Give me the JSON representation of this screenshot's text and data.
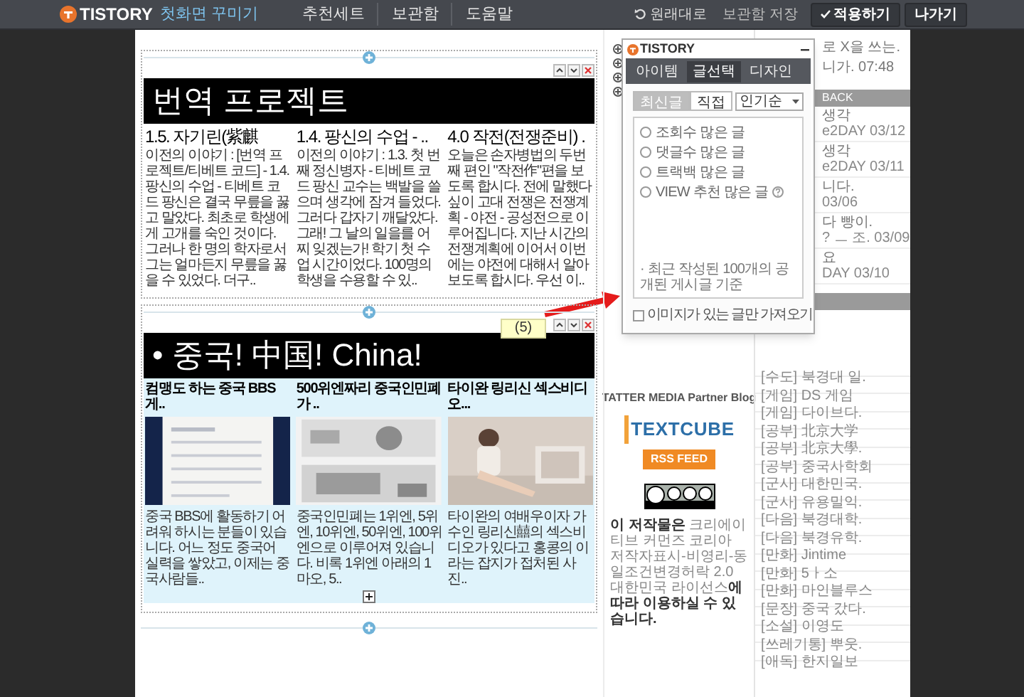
{
  "topbar": {
    "logo": "TISTORY",
    "title": "첫화면 꾸미기",
    "menu": [
      "추천세트",
      "보관함",
      "도움말"
    ],
    "actions": [
      {
        "label": "원래대로",
        "kind": "undo"
      },
      {
        "label": "보관함 저장",
        "kind": "link"
      },
      {
        "label": "적용하기",
        "kind": "primary"
      },
      {
        "label": "나가기",
        "kind": "button"
      }
    ]
  },
  "modules": [
    {
      "kind": "text",
      "title": "번역 프로젝트",
      "posts": [
        {
          "title": "1.5. 자기린(紫麒",
          "excerpt": "이전의 이야기 : [번역 프로젝트/티베트 코드] - 1.4. 팡신의 수업 - 티베트 코드 팡신은 결국 무릎을 꿇고 말았다. 최초로 학생에게 고개를 숙인 것이다. 그러나 한 명의 학자로서 그는 얼마든지 무릎을 꿇을 수 있었다. 더구.."
        },
        {
          "title": "1.4. 팡신의 수업 - ..",
          "excerpt": "이전의 이야기 : 1.3. 첫 번째 정신병자 - 티베트 코드 팡신 교수는 백발을 쓸으며 생각에 잠겨 들었다. 그러다 갑자기 깨달았다. 그래! 그 날의 일을를 어찌 잊겠는가! 학기 첫 수업 시간이었다. 100명의 학생을 수용할 수 있.."
        },
        {
          "title": "4.0 작전(전쟁준비) .",
          "excerpt": "오늘은 손자병법의 두번째 편인 \"작전作\"편을 보도록 합시다. 전에 말했다 싶이 고대 전쟁은 전쟁계획 - 야전 - 공성전으로 이루어집니다. 지난 시간의 전쟁계획에 이어서 이번에는 야전에 대해서 알아보도록 합시다. 우선 이.."
        }
      ]
    },
    {
      "title": "• 중국! 中国! China!",
      "posts": [
        {
          "title": "컴맹도 하는 중국 BBS 게..",
          "excerpt": "중국 BBS에 활동하기 어려워 하시는 분들이 있습니다. 어느 정도 중국어 실력을 쌓았고, 이제는 중국사람들.."
        },
        {
          "title": "500위엔짜리 중국인민폐가 ..",
          "excerpt": "중국인민폐는 1위엔, 5위엔, 10위엔, 50위엔, 100위엔으로 이루어져 있습니다. 비록 1위엔 아래의 1마오, 5.."
        },
        {
          "title": "타이완 링리신 섹스비디오...",
          "excerpt": "타이완의 여배우이자 가수인 링리신囍의 섹스비디오가 있다고 홍콩의 이라는 잡지가 접처된 사진.."
        }
      ]
    }
  ],
  "tooltip": "(5)",
  "popup": {
    "logo": "TISTORY",
    "tabs": [
      {
        "label": "아이템",
        "selected": false
      },
      {
        "label": "글선택",
        "selected": true
      },
      {
        "label": "디자인",
        "selected": false
      }
    ],
    "modes": [
      {
        "label": "최신글",
        "selected": true
      },
      {
        "label": "직접",
        "selected": false
      }
    ],
    "sort": "인기순",
    "options": [
      {
        "label": "조회수 많은 글",
        "selected": false
      },
      {
        "label": "댓글수 많은 글",
        "selected": false
      },
      {
        "label": "트랙백 많은 글",
        "selected": false
      },
      {
        "label": "VIEW 추천 많은 글",
        "selected": false,
        "help": true
      }
    ],
    "note": "· 최근 작성된 100개의 공개된 게시글 기준",
    "images_only": {
      "label": "이미지가 있는 글만 가져오기",
      "checked": false
    }
  },
  "sidebar": {
    "partner": "TATTER MEDIA Partner Blog",
    "textcube": "TEXTCUBE",
    "rss": "RSS FEED",
    "license": "**이 저작물은** 크리에이티브 커먼즈 코리아 저작자표시-비영리-동일조건변경허락 2.0 대한민국 라이선스**에 따라 이용하실 수 있습니다.**",
    "recent": [
      {
        "text": "로 X을 쓰는."
      },
      {
        "text": "니가. 07:48"
      }
    ],
    "recent_header": "BACK",
    "trackbacks": [
      {
        "line1": "생각",
        "line2": "e2DAY 03/12"
      },
      {
        "line1": "생각",
        "line2": "e2DAY 03/11"
      },
      {
        "line1": "니다.",
        "line2": "03/06"
      },
      {
        "line1": "다 빵이.",
        "line2": "? ㅡ 조. 03/09"
      },
      {
        "line1": "요",
        "line2": "DAY 03/10"
      }
    ],
    "categories": [
      "[수도] 북경대 일.",
      "[게임] DS 게임",
      "[게임] 다이브다.",
      "[공부] 北京大学",
      "[공부] 北京大學.",
      "[공부] 중국사학회",
      "[군사] 대한민국.",
      "[군사] 유용밀익.",
      "[다음] 북경대학.",
      "[다음] 북경유학.",
      "[만화] Jintime",
      "[만화] 5ㅏ소",
      "[만화] 마인블루스",
      "[문장] 중국 갔다.",
      "[소설] 이영도",
      "[쓰레기통] 뿌웃.",
      "[애독] 한지일보"
    ]
  }
}
